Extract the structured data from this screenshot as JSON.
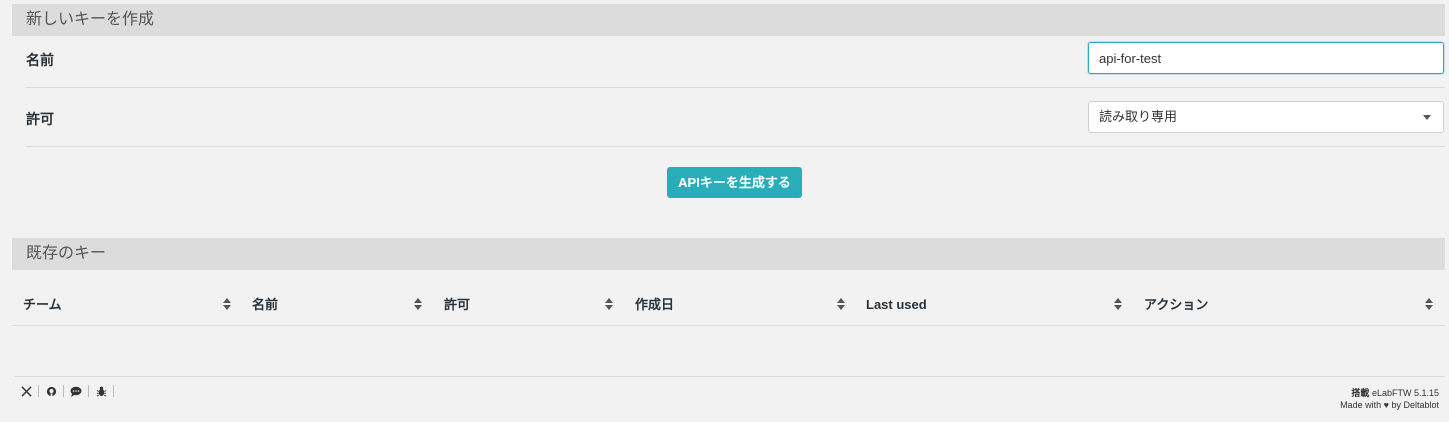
{
  "create_section": {
    "title": "新しいキーを作成",
    "name_label": "名前",
    "name_value": "api-for-test",
    "permission_label": "許可",
    "permission_selected": "読み取り専用",
    "generate_button": "APIキーを生成する"
  },
  "existing_section": {
    "title": "既存のキー",
    "columns": [
      "チーム",
      "名前",
      "許可",
      "作成日",
      "Last used",
      "アクション"
    ]
  },
  "footer": {
    "powered_prefix": "搭載",
    "powered_app": "eLabFTW 5.1.15",
    "made_with_prefix": "Made with",
    "heart": "♥",
    "made_with_suffix": "by Deltablot",
    "icons": [
      "x-twitter-icon",
      "github-icon",
      "chat-icon",
      "bug-icon"
    ]
  }
}
